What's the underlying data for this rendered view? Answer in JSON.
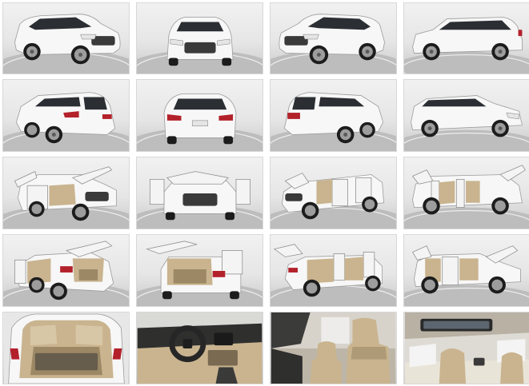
{
  "gallery": {
    "photos": [
      {
        "view": "front-left-three-quarter"
      },
      {
        "view": "front"
      },
      {
        "view": "front-right-three-quarter"
      },
      {
        "view": "right-side"
      },
      {
        "view": "rear-left-three-quarter"
      },
      {
        "view": "rear"
      },
      {
        "view": "rear-right-three-quarter"
      },
      {
        "view": "right-side-front-three-quarter"
      },
      {
        "view": "doors-hood-open-left"
      },
      {
        "view": "doors-hood-open-front"
      },
      {
        "view": "doors-hood-open-right"
      },
      {
        "view": "doors-liftgate-open-side"
      },
      {
        "view": "liftgate-open-rear-left"
      },
      {
        "view": "liftgate-open-rear"
      },
      {
        "view": "doors-open-rear-right"
      },
      {
        "view": "doors-hood-open-right-front"
      },
      {
        "view": "cargo-area"
      },
      {
        "view": "dashboard-interior"
      },
      {
        "view": "front-seats-interior"
      },
      {
        "view": "sunroof-headliner"
      }
    ]
  },
  "colors": {
    "vehicle_paint": "#f7f7f7",
    "tail_lamp": "#b3212b",
    "interior_leather": "#c9b48f",
    "studio_floor": "#bdbdbd"
  }
}
